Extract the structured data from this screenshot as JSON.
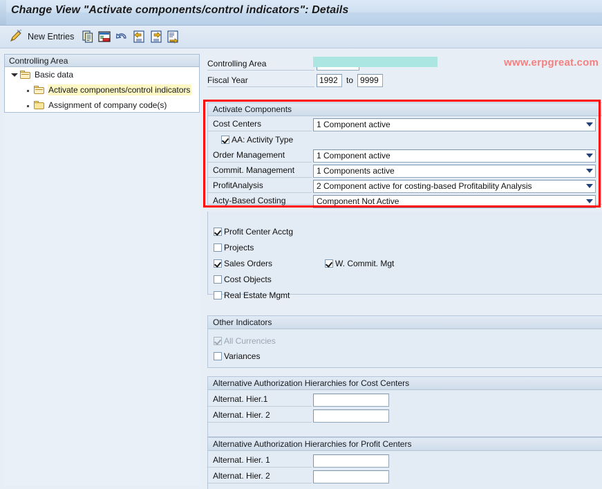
{
  "window": {
    "title": "Change View \"Activate components/control indicators\": Details"
  },
  "toolbar": {
    "change_icon_name": "pencil-wand-icon",
    "new_entries_label": "New Entries",
    "icons": [
      "copy-icon",
      "delete-row-icon",
      "undo-icon",
      "previous-entry-icon",
      "next-entry-icon",
      "other-entry-icon"
    ]
  },
  "tree": {
    "header": "Controlling Area",
    "items": [
      {
        "label": "Basic data",
        "level": 1,
        "expanded": true,
        "selected": false
      },
      {
        "label": "Activate components/control indicators",
        "level": 2,
        "expanded": false,
        "selected": true
      },
      {
        "label": "Assignment of company code(s)",
        "level": 2,
        "expanded": false,
        "selected": false
      }
    ]
  },
  "header_fields": {
    "controlling_area_label": "Controlling Area",
    "controlling_area_value": "",
    "fiscal_year_label": "Fiscal Year",
    "fiscal_year_from": "1992",
    "fiscal_year_to_text": "to",
    "fiscal_year_to": "9999"
  },
  "watermark": "www.erpgreat.com",
  "activate_components": {
    "title": "Activate Components",
    "rows": [
      {
        "label": "Cost Centers",
        "value": "1 Component active"
      },
      {
        "label": "Order Management",
        "value": "1 Component active"
      },
      {
        "label": "Commit. Management",
        "value": "1 Components active"
      },
      {
        "label": "ProfitAnalysis",
        "value": "2 Component active for costing-based Profitability Analysis"
      },
      {
        "label": "Acty-Based Costing",
        "value": "Component Not Active"
      }
    ],
    "activity_type_checkbox": {
      "label": "AA: Activity Type",
      "checked": true
    }
  },
  "indicators": {
    "left": [
      {
        "label": "Profit Center Acctg",
        "checked": true
      },
      {
        "label": "Projects",
        "checked": false
      },
      {
        "label": "Sales Orders",
        "checked": true
      },
      {
        "label": "Cost Objects",
        "checked": false
      },
      {
        "label": "Real Estate Mgmt",
        "checked": false
      }
    ],
    "right": [
      {
        "label": "W. Commit. Mgt",
        "checked": true
      }
    ]
  },
  "other_indicators": {
    "title": "Other Indicators",
    "items": [
      {
        "label": "All Currencies",
        "checked": true,
        "disabled": true
      },
      {
        "label": "Variances",
        "checked": false,
        "disabled": false
      }
    ]
  },
  "alt_hier_cost_centers": {
    "title": "Alternative Authorization Hierarchies for Cost Centers",
    "rows": [
      {
        "label": "Alternat. Hier.1",
        "value": ""
      },
      {
        "label": "Alternat. Hier. 2",
        "value": ""
      }
    ]
  },
  "alt_hier_profit_centers": {
    "title": "Alternative Authorization Hierarchies for Profit Centers",
    "rows": [
      {
        "label": "Alternat. Hier. 1",
        "value": ""
      },
      {
        "label": "Alternat. Hier. 2",
        "value": ""
      }
    ]
  },
  "colors": {
    "highlight_box": "#ff0000",
    "tree_selection": "#fdf7c3",
    "watermark": "#f58080",
    "redaction": "#abe6e2",
    "panel_bg": "#e3ebf4"
  }
}
